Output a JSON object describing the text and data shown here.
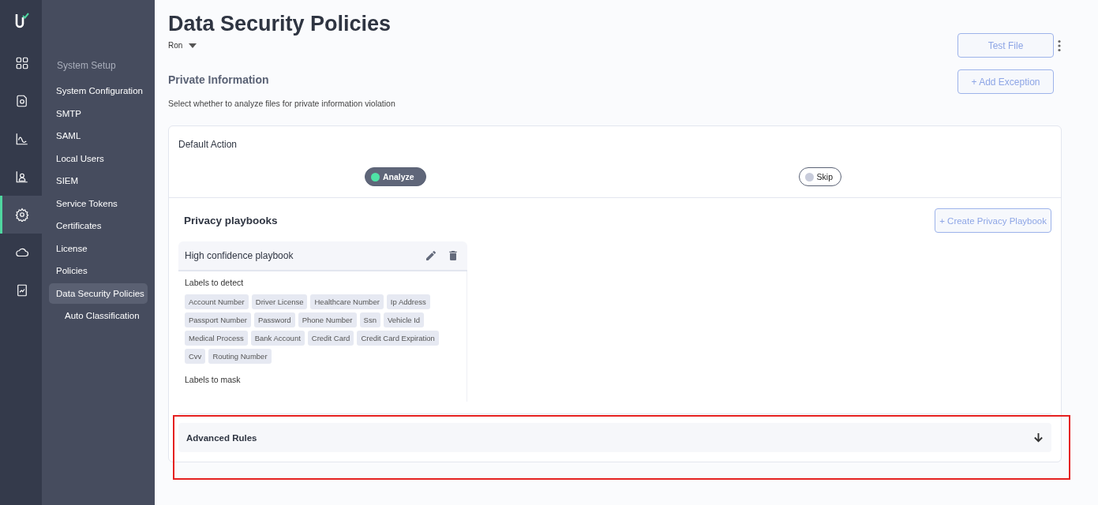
{
  "rail": [
    {
      "kind": "grid",
      "selected": false
    },
    {
      "kind": "file",
      "selected": false
    },
    {
      "kind": "chart",
      "selected": false
    },
    {
      "kind": "person-chart",
      "selected": false
    },
    {
      "kind": "gear",
      "selected": true
    },
    {
      "kind": "cloud",
      "selected": false
    },
    {
      "kind": "report",
      "selected": false
    }
  ],
  "nav": {
    "section": "System Setup",
    "items": [
      {
        "label": "System Configuration",
        "selected": false
      },
      {
        "label": "SMTP",
        "selected": false
      },
      {
        "label": "SAML",
        "selected": false
      },
      {
        "label": "Local Users",
        "selected": false
      },
      {
        "label": "SIEM",
        "selected": false
      },
      {
        "label": "Service Tokens",
        "selected": false
      },
      {
        "label": "Certificates",
        "selected": false
      },
      {
        "label": "License",
        "selected": false
      },
      {
        "label": "Policies",
        "selected": false
      },
      {
        "label": "Data Security Policies",
        "selected": true,
        "children": [
          {
            "label": "Auto Classification",
            "selected": false
          }
        ]
      }
    ]
  },
  "header": {
    "title": "Data Security Policies",
    "user": "Ron",
    "test_button": "Test File"
  },
  "section": {
    "title": "Private Information",
    "description": "Select whether to analyze files for private information violation",
    "add_button": "+ Add Exception"
  },
  "default_action": {
    "title": "Default Action",
    "options": [
      {
        "label": "Analyze",
        "selected": true
      },
      {
        "label": "Skip",
        "selected": false
      }
    ]
  },
  "playbooks": {
    "title": "Privacy playbooks",
    "create_button": "+ Create Privacy Playbook",
    "items": [
      {
        "name": "High confidence playbook",
        "groups": [
          {
            "title": "Labels to detect",
            "labels": [
              "Account Number",
              "Driver License",
              "Healthcare Number",
              "Ip Address",
              "Passport Number",
              "Password",
              "Phone Number",
              "Ssn",
              "Vehicle Id",
              "Medical Process",
              "Bank Account",
              "Credit Card",
              "Credit Card Expiration",
              "Cvv",
              "Routing Number"
            ]
          },
          {
            "title": "Labels to mask"
          }
        ]
      }
    ]
  },
  "advanced": {
    "title": "Advanced Rules",
    "expanded": false
  }
}
